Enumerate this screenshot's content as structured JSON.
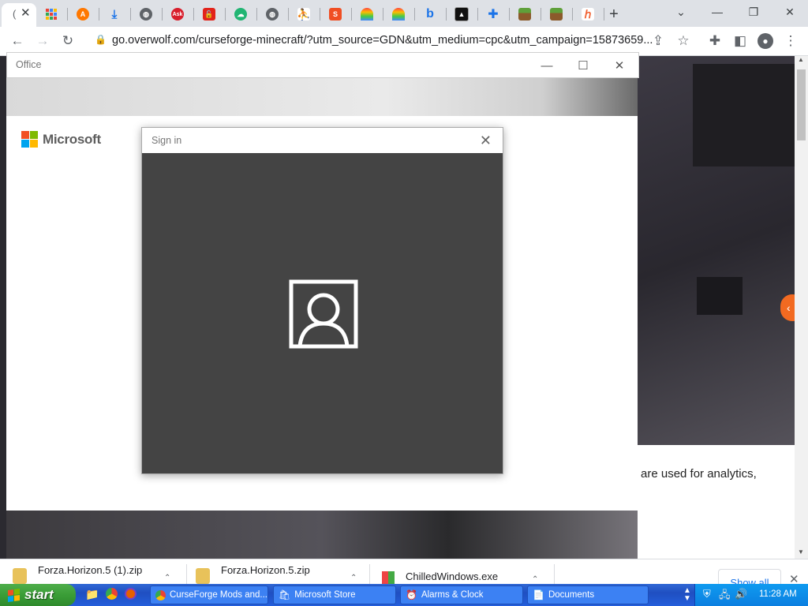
{
  "browser": {
    "active_tab_label": "(",
    "tab_icons": [
      "apps-grid-icon",
      "avast-icon",
      "download-icon",
      "globe-icon",
      "ask-icon",
      "unlock-icon",
      "cloud-icon",
      "globe-icon",
      "person-icon",
      "shield-s-icon",
      "rainbow-icon",
      "rainbow-icon",
      "bing-icon",
      "photo-icon",
      "puzzle-icon",
      "minecraft-block-icon",
      "minecraft-block-icon",
      "curseforge-icon"
    ],
    "new_tab_label": "+",
    "url": "go.overwolf.com/curseforge-minecraft/?utm_source=GDN&utm_medium=cpc&utm_campaign=15873659..."
  },
  "office_window": {
    "title": "Office"
  },
  "microsoft_panel": {
    "brand": "Microsoft",
    "colors": [
      "#f25022",
      "#7fba00",
      "#00a4ef",
      "#ffb900"
    ]
  },
  "signin_dialog": {
    "title": "Sign in"
  },
  "page": {
    "cookie_text_fragment": "are used for analytics,"
  },
  "downloads": {
    "items": [
      {
        "name": "Forza.Horizon.5 (1).zip"
      },
      {
        "name": "Forza.Horizon.5.zip"
      },
      {
        "name": "ChilledWindows.exe"
      }
    ],
    "show_all": "Show all"
  },
  "taskbar": {
    "start": "start",
    "tasks": [
      {
        "label": "CurseForge Mods and..."
      },
      {
        "label": "Microsoft Store"
      },
      {
        "label": "Alarms & Clock"
      },
      {
        "label": "Documents"
      }
    ],
    "clock": "11:28 AM"
  }
}
